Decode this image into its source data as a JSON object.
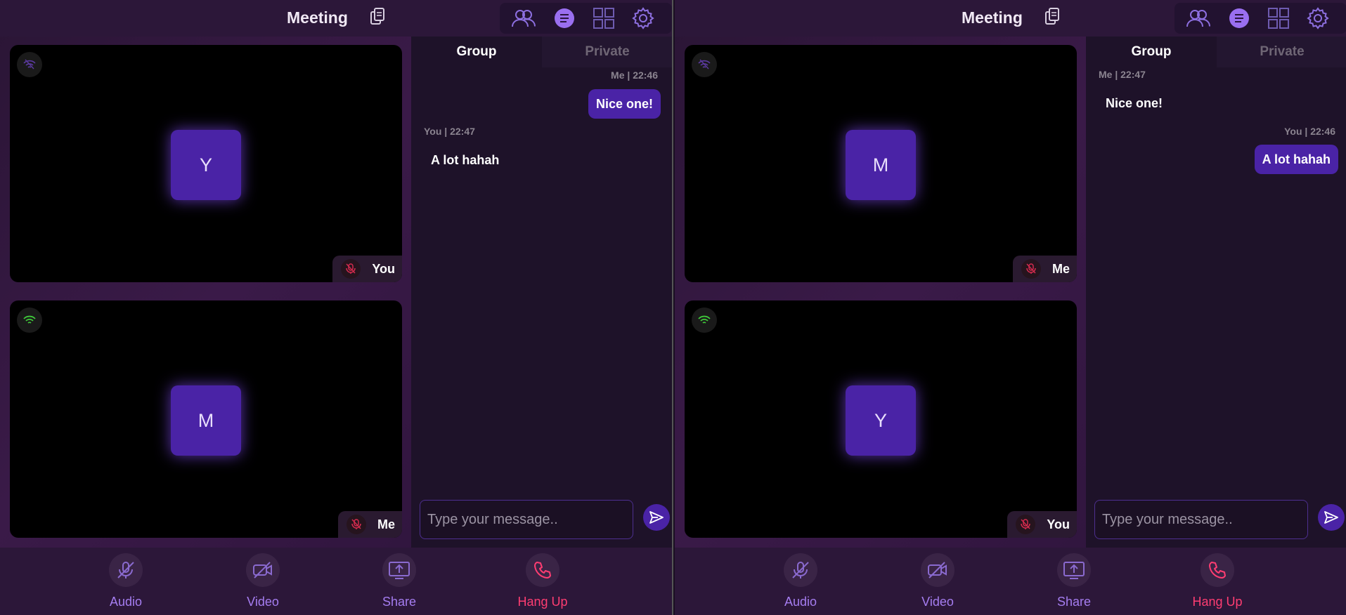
{
  "header": {
    "title": "Meeting"
  },
  "icons": {
    "copy": "copy-icon",
    "participants": "participants-icon",
    "chat": "chat-icon",
    "layout": "grid-layout-icon",
    "settings": "gear-icon"
  },
  "chat": {
    "tabs": {
      "group": "Group",
      "private": "Private"
    },
    "placeholder": "Type your message.."
  },
  "footer": {
    "audio": "Audio",
    "video": "Video",
    "share": "Share",
    "hangup": "Hang Up"
  },
  "colors": {
    "accent": "#4a23a6",
    "label": "#a57df0",
    "hangup": "#ff3d72",
    "mic_off": "#d32b4e",
    "signal_on": "#3fc93a",
    "signal_weak": "#5b3aa0"
  },
  "panes": [
    {
      "tiles": [
        {
          "avatar": "Y",
          "name": "You",
          "signal": "weak"
        },
        {
          "avatar": "M",
          "name": "Me",
          "signal": "on"
        }
      ],
      "messages": [
        {
          "meta": "Me | 22:46",
          "text": "Nice one!",
          "mine": true
        },
        {
          "meta": "You | 22:47",
          "text": "A lot hahah",
          "mine": false
        }
      ]
    },
    {
      "tiles": [
        {
          "avatar": "M",
          "name": "Me",
          "signal": "weak"
        },
        {
          "avatar": "Y",
          "name": "You",
          "signal": "on"
        }
      ],
      "messages": [
        {
          "meta": "Me | 22:47",
          "text": "Nice one!",
          "mine": false
        },
        {
          "meta": "You | 22:46",
          "text": "A lot hahah",
          "mine": true
        }
      ]
    }
  ]
}
